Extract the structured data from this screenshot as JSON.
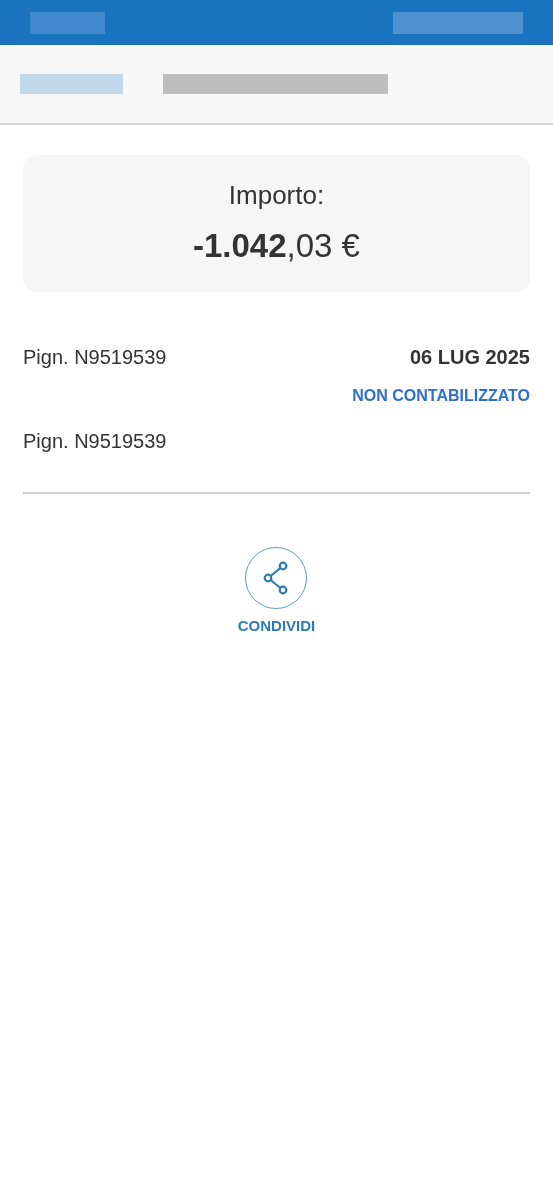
{
  "amount": {
    "label": "Importo:",
    "value": "**-1.042**,03 €"
  },
  "transaction": {
    "description": "Pign. N9519539",
    "date": "06 LUG 2025",
    "status": "NON CONTABILIZZATO",
    "details": "Pign. N9519539"
  },
  "actions": [
    {
      "label": "CONDIVIDI",
      "kind": "share"
    }
  ]
}
